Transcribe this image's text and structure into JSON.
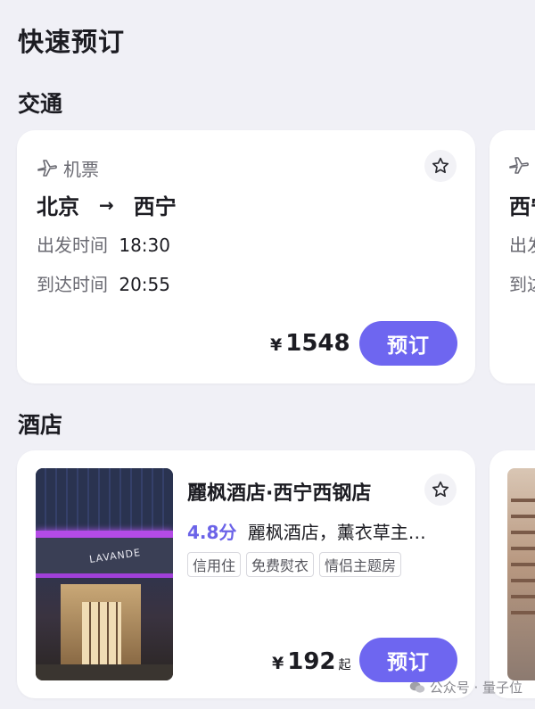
{
  "page_title": "快速预订",
  "transport": {
    "section_title": "交通",
    "flight_card": {
      "type_label": "机票",
      "from_city": "北京",
      "arrow": "→",
      "to_city": "西宁",
      "depart_label": "出发时间",
      "depart_time": "18:30",
      "arrive_label": "到达时间",
      "arrive_time": "20:55",
      "currency": "¥",
      "price": "1548",
      "book_label": "预订"
    },
    "peek_card": {
      "city_partial": "西宁",
      "label_partial_1": "出发",
      "label_partial_2": "到达"
    }
  },
  "hotel": {
    "section_title": "酒店",
    "hotel_card": {
      "name": "麗枫酒店·西宁西钢店",
      "rating": "4.8分",
      "description": "麗枫酒店，薰衣草主…",
      "tags": [
        "信用住",
        "免费熨衣",
        "情侣主题房"
      ],
      "currency": "¥",
      "price": "192",
      "price_suffix": "起",
      "book_label": "预订",
      "sign_text": "LAVANDE"
    }
  },
  "watermark": "公众号 · 量子位",
  "colors": {
    "accent": "#6e66f0",
    "rating": "#6b63e8",
    "background": "#f0f0f6"
  }
}
